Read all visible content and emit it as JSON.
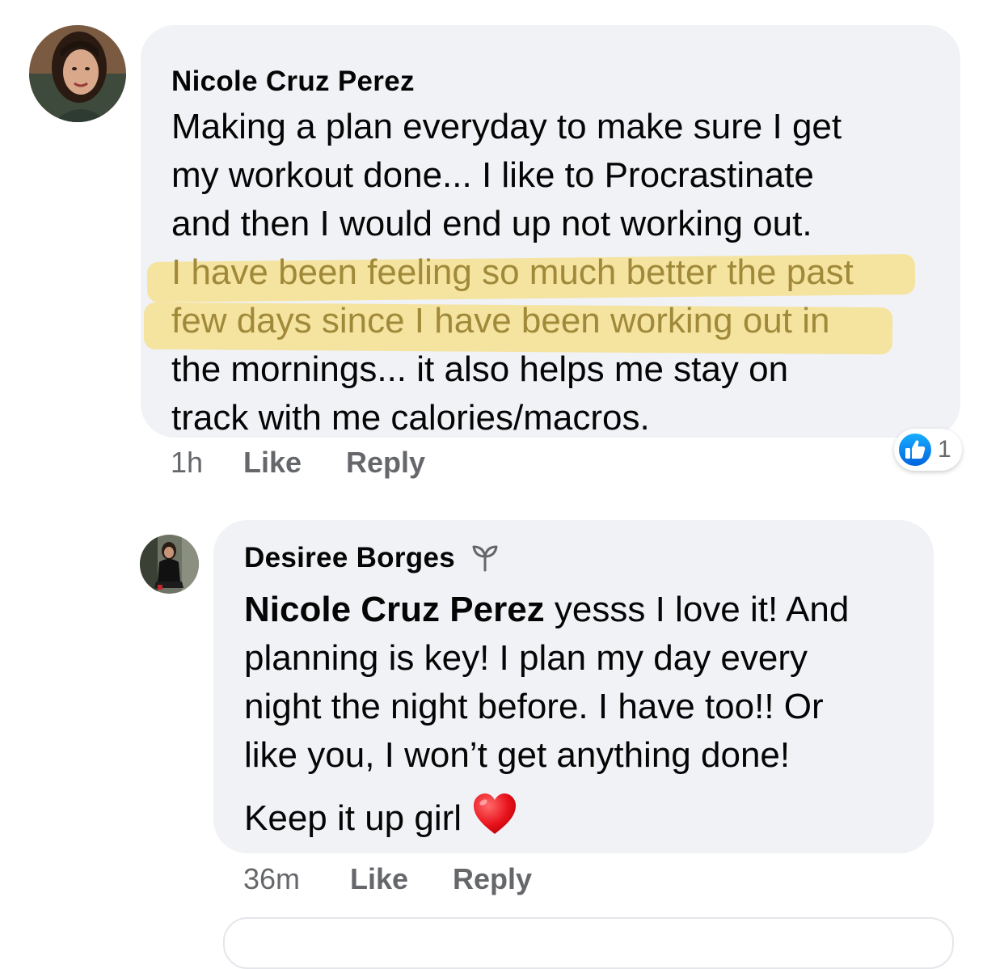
{
  "comments": [
    {
      "author": "Nicole Cruz Perez",
      "lines": [
        "Making a plan everyday to make sure I get",
        "my workout done... I like to  Procrastinate",
        "and then I would end up not working out.",
        "I have been feeling so much better the past",
        "few days since I have been working out in",
        "the mornings... it also helps me stay on",
        "track with me calories/macros."
      ],
      "time": "1h",
      "like_label": "Like",
      "reply_label": "Reply",
      "reaction_count": "1"
    },
    {
      "author": "Desiree Borges",
      "mention": "Nicole Cruz Perez",
      "lines": [
        " yesss I love it! And",
        "planning is key! I plan my day every",
        "night the night before. I have too!! Or",
        "like you, I won’t get anything done!"
      ],
      "closing": "Keep it up girl ",
      "time": "36m",
      "like_label": "Like",
      "reply_label": "Reply"
    }
  ],
  "colors": {
    "bubble": "#f0f2f5",
    "secondary_text": "#65676b",
    "like_blue": "#1877f2",
    "highlight": "#fad75a"
  },
  "icons": {
    "reaction": "like-thumb-icon",
    "badge": "seedling-icon",
    "emoji": "red-heart-icon"
  }
}
